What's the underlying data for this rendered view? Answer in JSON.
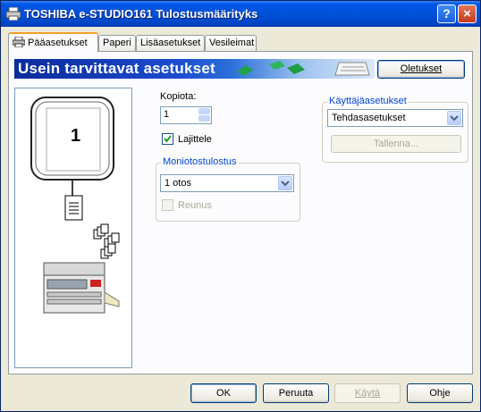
{
  "window": {
    "title": "TOSHIBA e-STUDIO161 Tulostusmäärityks"
  },
  "titlebar": {
    "help_label": "?",
    "close_label": "×"
  },
  "tabs": [
    {
      "label": "Pääasetukset",
      "active": true
    },
    {
      "label": "Paperi"
    },
    {
      "label": "Lisäasetukset"
    },
    {
      "label": "Vesileimat"
    }
  ],
  "banner": {
    "title": "Usein tarvittavat asetukset"
  },
  "buttons": {
    "defaults": "Oletukset",
    "save": "Tallenna...",
    "ok": "OK",
    "cancel": "Peruuta",
    "apply": "Käytä",
    "help": "Ohje"
  },
  "preview": {
    "page_number": "1"
  },
  "copies": {
    "label": "Kopiota:",
    "value": "1"
  },
  "collate": {
    "label": "Lajittele",
    "checked": true
  },
  "multiup": {
    "group_label": "Moniotostulostus",
    "selected": "1 otos",
    "border_label": "Reunus",
    "border_checked": false
  },
  "user_settings": {
    "group_label": "Käyttäjäasetukset",
    "selected": "Tehdasasetukset"
  },
  "colors": {
    "title_bar": "#0054e3",
    "accent": "#f2a12a",
    "checkbox_green": "#21a121"
  }
}
